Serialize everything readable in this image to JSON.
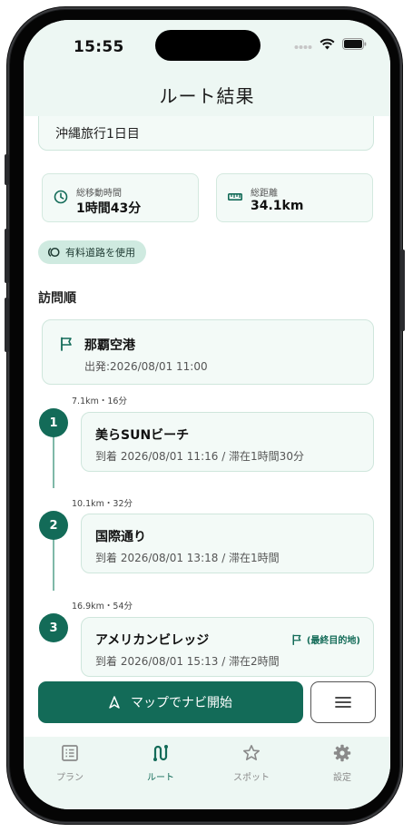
{
  "status_bar": {
    "time": "15:55"
  },
  "header": {
    "title": "ルート結果"
  },
  "trip": {
    "name": "沖縄旅行1日目"
  },
  "stats": {
    "duration": {
      "label": "総移動時間",
      "value": "1時間43分",
      "icon": "clock-icon"
    },
    "distance": {
      "label": "総距離",
      "value": "34.1km",
      "icon": "ruler-icon"
    }
  },
  "chip": {
    "label": "有料道路を使用",
    "icon": "toll-road-icon"
  },
  "section": {
    "title": "訪問順"
  },
  "start": {
    "name": "那覇空港",
    "detail": "出発:2026/08/01 11:00",
    "icon": "flag-icon"
  },
  "stops": [
    {
      "number": "1",
      "leg": "7.1km・16分",
      "name": "美らSUNビーチ",
      "detail": "到着 2026/08/01 11:16 / 滞在1時間30分"
    },
    {
      "number": "2",
      "leg": "10.1km・32分",
      "name": "国際通り",
      "detail": "到着 2026/08/01 13:18 / 滞在1時間"
    },
    {
      "number": "3",
      "leg": "16.9km・54分",
      "name": "アメリカンビレッジ",
      "detail": "到着 2026/08/01 15:13 / 滞在2時間",
      "badge": "(最終目的地)"
    }
  ],
  "actions": {
    "navi_label": "マップでナビ開始",
    "navi_icon": "navigation-arrow-icon",
    "menu_icon": "menu-icon"
  },
  "tabs": [
    {
      "label": "プラン",
      "icon": "list-icon"
    },
    {
      "label": "ルート",
      "icon": "route-icon",
      "active": true
    },
    {
      "label": "スポット",
      "icon": "star-icon"
    },
    {
      "label": "設定",
      "icon": "gear-icon"
    }
  ],
  "colors": {
    "primary": "#136b58",
    "surface": "#edf7f3",
    "card": "#f3faf7"
  }
}
